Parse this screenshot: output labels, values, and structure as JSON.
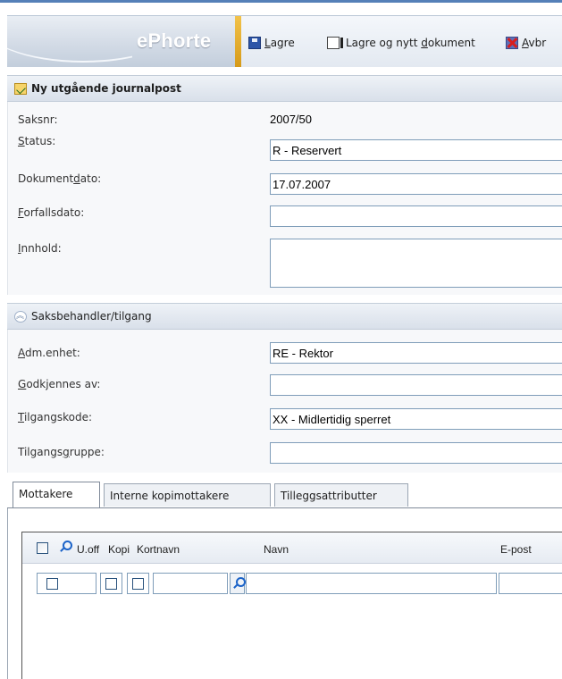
{
  "app": {
    "logo_text": "ePhorte",
    "accent_color": "#5580b8",
    "logo_stripe_color": "#e2a930"
  },
  "toolbar": {
    "save": {
      "icon": "floppy-disk-icon",
      "underline": "L",
      "rest": "agre"
    },
    "save_new": {
      "icon": "new-document-icon",
      "pre": "Lagre og nytt ",
      "underline": "d",
      "post": "okument"
    },
    "cancel": {
      "icon": "cancel-icon",
      "underline": "A",
      "rest": "vbr"
    }
  },
  "journal_panel": {
    "title": "Ny utgående journalpost",
    "fields": {
      "saksnr": {
        "label": "Saksnr:",
        "value": "2007/50"
      },
      "status": {
        "label_u": "S",
        "label_rest": "tatus:",
        "value": "R - Reservert"
      },
      "dokumentdato": {
        "label_pre": "Dokument",
        "label_u": "d",
        "label_post": "ato:",
        "value": "17.07.2007"
      },
      "forfallsdato": {
        "label_u": "F",
        "label_rest": "orfallsdato:",
        "value": ""
      },
      "innhold": {
        "label_u": "I",
        "label_rest": "nnhold:",
        "value": ""
      }
    }
  },
  "access_panel": {
    "title": "Saksbehandler/tilgang",
    "fields": {
      "adm_enhet": {
        "label_u": "A",
        "label_rest": "dm.enhet:",
        "value": "RE - Rektor"
      },
      "godkjennes": {
        "label_u": "G",
        "label_rest": "odkjennes av:",
        "value": ""
      },
      "tilgangskode": {
        "label_u": "T",
        "label_rest": "ilgangskode:",
        "value": "XX - Midlertidig sperret"
      },
      "tilgangsgruppe": {
        "label_pre": "Tilgangs",
        "label_u": "g",
        "label_post": "ruppe:",
        "value": ""
      }
    }
  },
  "tabs": [
    {
      "label": "Mottakere",
      "active": true
    },
    {
      "label": "Interne kopimottakere",
      "active": false
    },
    {
      "label": "Tilleggsattributter",
      "active": false
    }
  ],
  "grid": {
    "columns": {
      "uoff": "U.off",
      "kopi": "Kopi",
      "kortnavn": "Kortnavn",
      "navn": "Navn",
      "epost": "E-post"
    }
  }
}
